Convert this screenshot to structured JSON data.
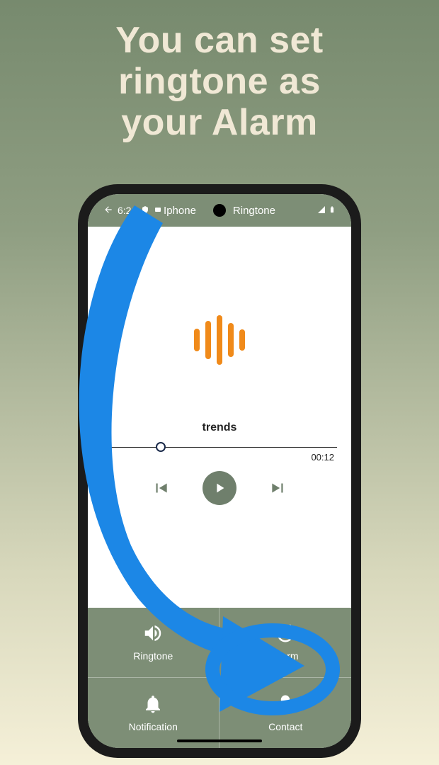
{
  "hero": {
    "line1": "You can set",
    "line2": "ringtone as",
    "line3": "your Alarm"
  },
  "status": {
    "time": "6:26",
    "app_title_left": "Iphone",
    "app_title_right": "Ringtone"
  },
  "player": {
    "track_title": "trends",
    "elapsed": "00:12"
  },
  "actions": {
    "ringtone": "Ringtone",
    "alarm": "Alarm",
    "notification": "Notification",
    "contact": "Contact"
  },
  "colors": {
    "accent_green": "#7d8e76",
    "wave_orange": "#f08a1a",
    "arrow_blue": "#1c87e6"
  }
}
